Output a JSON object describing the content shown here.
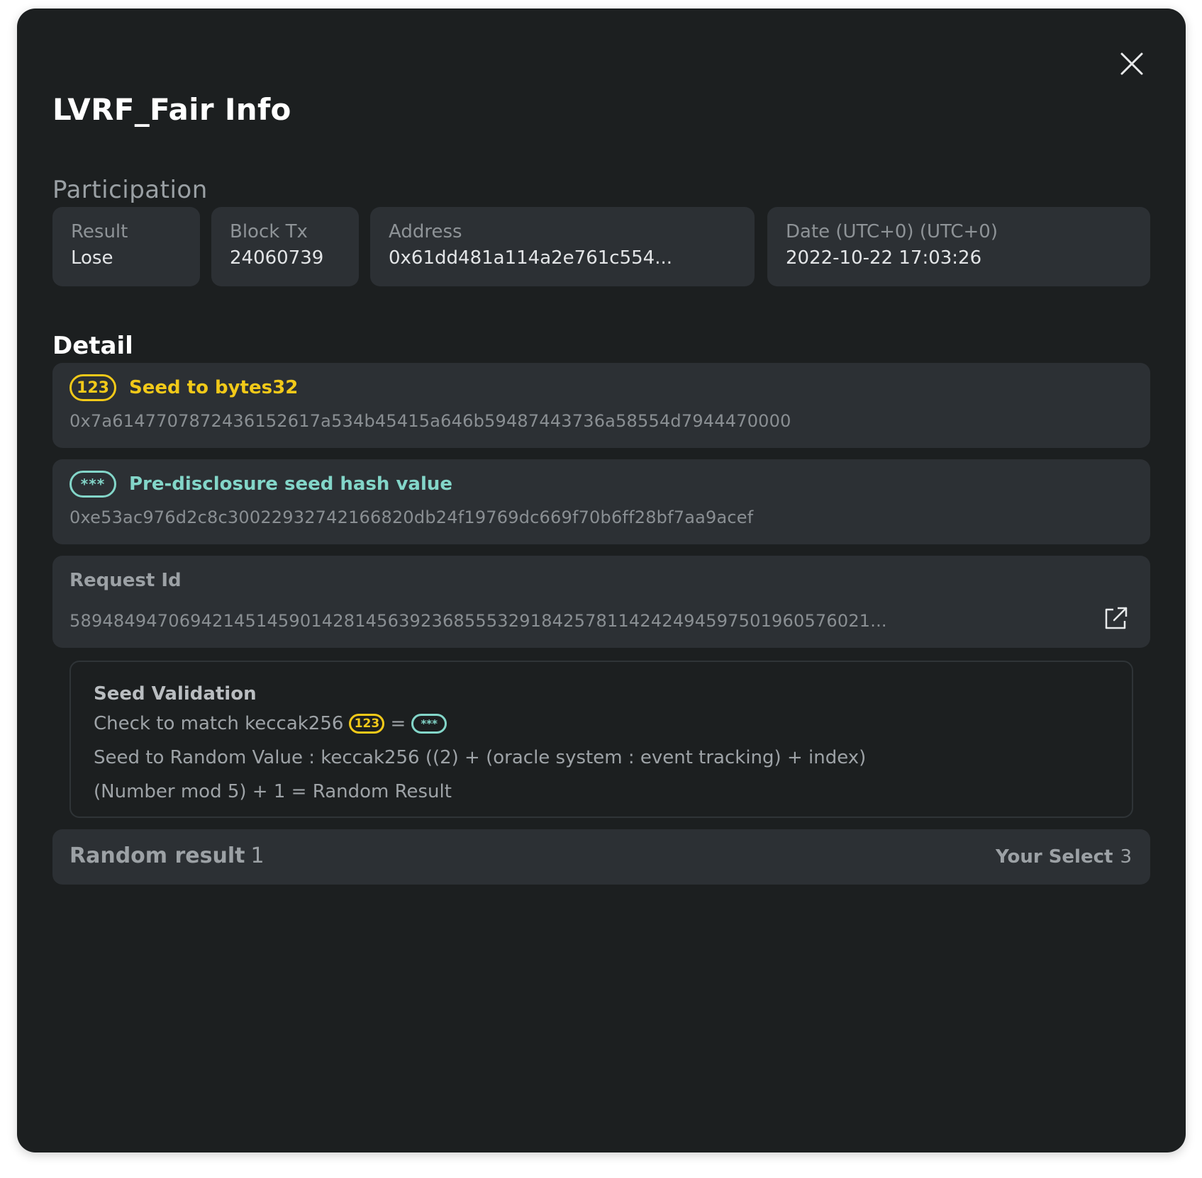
{
  "modal": {
    "title": "LVRF_Fair Info"
  },
  "participation": {
    "heading": "Participation",
    "result": {
      "label": "Result",
      "value": "Lose"
    },
    "block_tx": {
      "label": "Block Tx",
      "value": "24060739"
    },
    "address": {
      "label": "Address",
      "value": "0x61dd481a114a2e761c554..."
    },
    "date": {
      "label": "Date (UTC+0) (UTC+0)",
      "value": "2022-10-22 17:03:26"
    }
  },
  "detail": {
    "heading": "Detail",
    "seed": {
      "badge": "123",
      "title": "Seed to bytes32",
      "value": "0x7a614770787243615261 7a534b45415a646b59487443736a58554d7944470000",
      "color": "#f2c919"
    },
    "prehash": {
      "badge": "***",
      "title": "Pre-disclosure seed hash value",
      "value": "0xe53ac976d2c8c30022932742166820db24f19769dc669f70b6ff28bf7aa9acef",
      "color": "#83d6c9"
    },
    "request": {
      "label": "Request Id",
      "value": "58948494706942145145901428145639236855532918425781142424945975019605760 21..."
    }
  },
  "validation": {
    "title": "Seed Validation",
    "line1_prefix": "Check to match keccak256",
    "line1_badge1": "123",
    "line1_eq": "=",
    "line1_badge2": "***",
    "line2": "Seed to Random Value : keccak256 ((2) + (oracle system : event tracking) + index)",
    "line3": "(Number mod 5) + 1 = Random Result"
  },
  "result": {
    "label": "Random result",
    "value": "1",
    "your_select_label": "Your Select",
    "your_select_value": "3"
  },
  "icons": {
    "close": "close-icon",
    "external": "external-link-icon"
  }
}
